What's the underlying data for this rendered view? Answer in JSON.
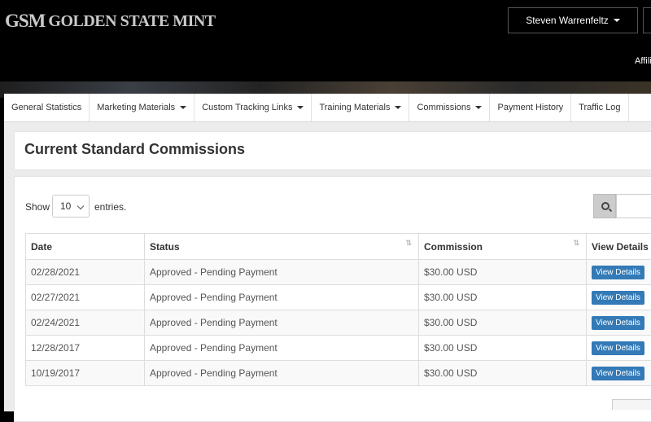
{
  "brand": {
    "mark": "GSM",
    "name": "GOLDEN STATE MINT"
  },
  "header": {
    "user_name": "Steven Warrenfeltz",
    "affiliate_label": "Affili"
  },
  "nav": {
    "items": [
      {
        "label": "General Statistics",
        "dropdown": false
      },
      {
        "label": "Marketing Materials",
        "dropdown": true
      },
      {
        "label": "Custom Tracking Links",
        "dropdown": true
      },
      {
        "label": "Training Materials",
        "dropdown": true
      },
      {
        "label": "Commissions",
        "dropdown": true
      },
      {
        "label": "Payment History",
        "dropdown": false
      },
      {
        "label": "Traffic Log",
        "dropdown": false
      }
    ]
  },
  "page": {
    "title": "Current Standard Commissions"
  },
  "table_controls": {
    "show_label": "Show",
    "entries_value": "10",
    "entries_label": "entries."
  },
  "table": {
    "headers": {
      "date": "Date",
      "status": "Status",
      "commission": "Commission",
      "details": "View Details"
    },
    "rows": [
      {
        "date": "02/28/2021",
        "status": "Approved - Pending Payment",
        "commission": "$30.00 USD",
        "action": "View Details"
      },
      {
        "date": "02/27/2021",
        "status": "Approved - Pending Payment",
        "commission": "$30.00 USD",
        "action": "View Details"
      },
      {
        "date": "02/24/2021",
        "status": "Approved - Pending Payment",
        "commission": "$30.00 USD",
        "action": "View Details"
      },
      {
        "date": "12/28/2017",
        "status": "Approved - Pending Payment",
        "commission": "$30.00 USD",
        "action": "View Details"
      },
      {
        "date": "10/19/2017",
        "status": "Approved - Pending Payment",
        "commission": "$30.00 USD",
        "action": "View Details"
      }
    ]
  },
  "colors": {
    "accent": "#337ab7",
    "header_bg": "#000000",
    "content_bg": "#ececec"
  },
  "icons": {
    "search": "search-icon",
    "dropdown": "caret-down-icon",
    "sort": "sort-icon"
  }
}
